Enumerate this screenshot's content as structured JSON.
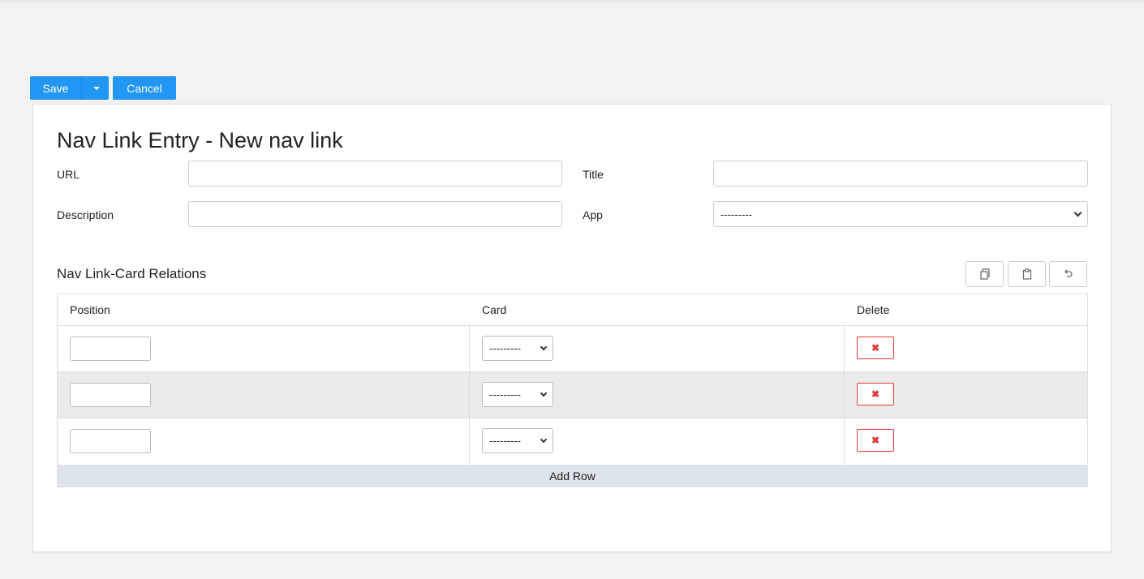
{
  "toolbar": {
    "save_label": "Save",
    "cancel_label": "Cancel"
  },
  "form": {
    "title": "Nav Link Entry - New nav link",
    "fields": {
      "url": {
        "label": "URL",
        "value": ""
      },
      "title": {
        "label": "Title",
        "value": ""
      },
      "description": {
        "label": "Description",
        "value": ""
      },
      "app": {
        "label": "App",
        "selected": "---------"
      }
    }
  },
  "relations": {
    "title": "Nav Link-Card Relations",
    "columns": [
      "Position",
      "Card",
      "Delete"
    ],
    "rows": [
      {
        "position": "",
        "card": "---------"
      },
      {
        "position": "",
        "card": "---------"
      },
      {
        "position": "",
        "card": "---------"
      }
    ],
    "add_row_label": "Add Row",
    "actions": [
      "copy-icon",
      "clipboard-icon",
      "undo-icon"
    ]
  },
  "colors": {
    "primary": "#2196f3",
    "danger": "#e53935",
    "add_row_bg": "#dde3ea"
  }
}
